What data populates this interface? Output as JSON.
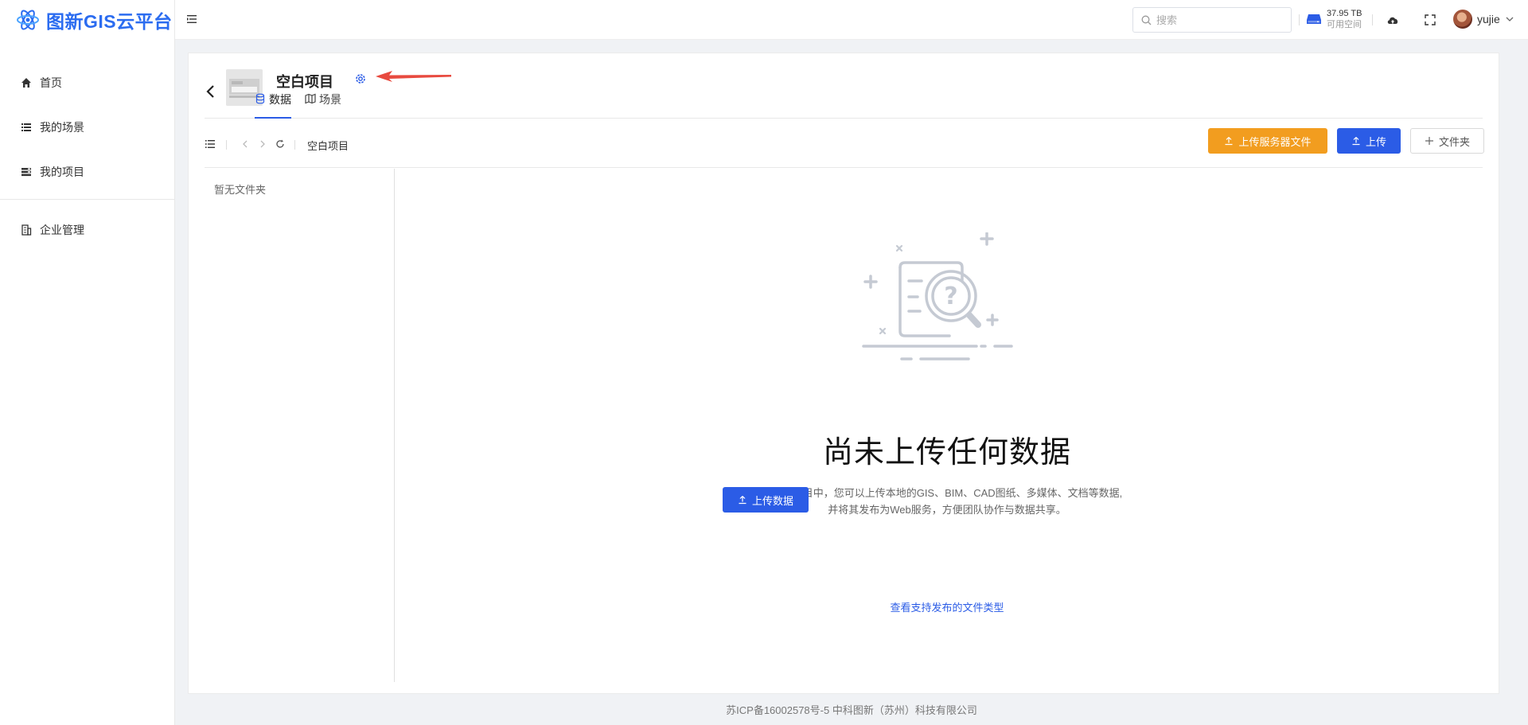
{
  "brand": {
    "name": "图新GIS云平台",
    "color": "#2b6cf0"
  },
  "sidebar": {
    "items": [
      {
        "label": "首页",
        "icon": "home-icon"
      },
      {
        "label": "我的场景",
        "icon": "list-icon"
      },
      {
        "label": "我的项目",
        "icon": "projects-icon"
      },
      {
        "label": "企业管理",
        "icon": "building-icon"
      }
    ]
  },
  "header": {
    "search_placeholder": "搜索",
    "storage_value": "37.95 TB",
    "storage_label": "可用空间",
    "username": "yujie"
  },
  "project": {
    "title": "空白项目",
    "tabs": [
      {
        "label": "数据",
        "icon": "database-icon",
        "active": true
      },
      {
        "label": "场景",
        "icon": "map-icon",
        "active": false
      }
    ]
  },
  "toolbar": {
    "breadcrumb": "空白项目",
    "upload_server_label": "上传服务器文件",
    "upload_label": "上传",
    "folder_label": "文件夹"
  },
  "folders": {
    "empty_text": "暂无文件夹"
  },
  "empty_state": {
    "title": "尚未上传任何数据",
    "desc_line1": "在此项目中，您可以上传本地的GIS、BIM、CAD图纸、多媒体、文档等数据,",
    "desc_line2": "并将其发布为Web服务，方便团队协作与数据共享。",
    "upload_button": "上传数据",
    "types_link": "查看支持发布的文件类型"
  },
  "footer": {
    "text": "苏ICP备16002578号-5 中科图新（苏州）科技有限公司"
  },
  "colors": {
    "primary": "#2b5ce6",
    "orange": "#f29d1f",
    "annotation_arrow": "#e84a3f"
  }
}
